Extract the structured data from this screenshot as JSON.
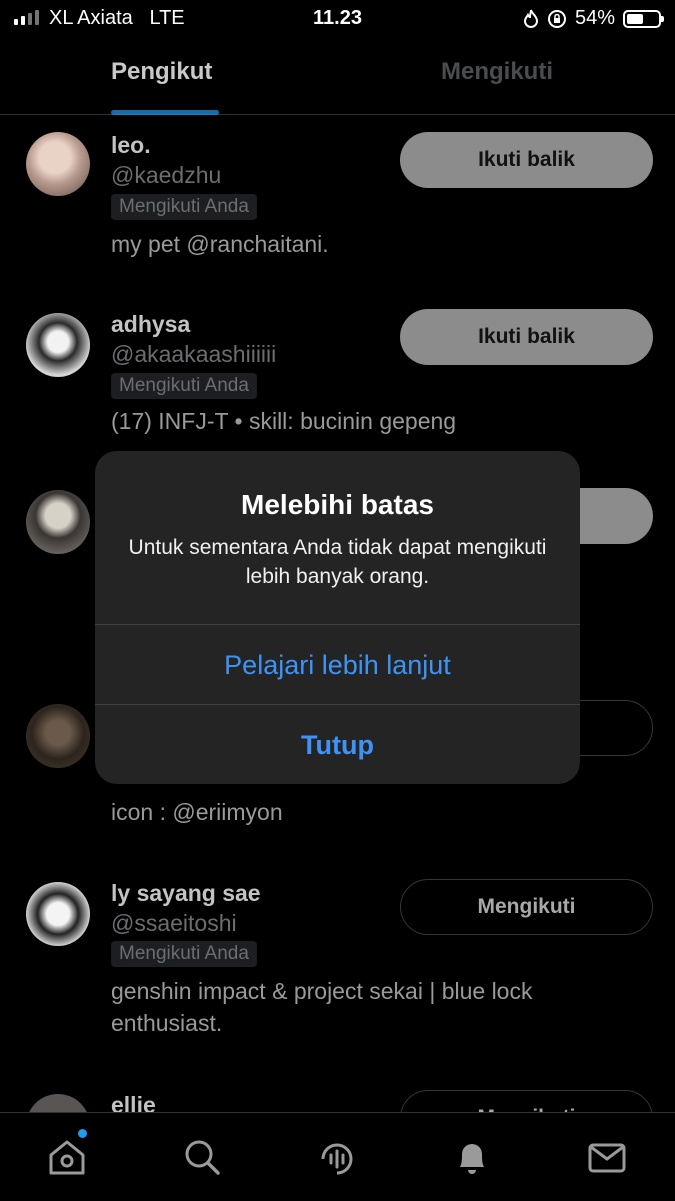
{
  "status_bar": {
    "carrier": "XL Axiata",
    "network": "LTE",
    "time": "11.23",
    "battery": "54%",
    "battery_level": 0.54
  },
  "tabs": [
    {
      "label": "Pengikut",
      "active": true
    },
    {
      "label": "Mengikuti",
      "active": false
    }
  ],
  "followers": [
    {
      "name": "leo.",
      "handle": "@kaedzhu",
      "badge": "Mengikuti Anda",
      "bio": "my pet @ranchaitani.",
      "button": "Ikuti balik"
    },
    {
      "name": "adhysa",
      "handle": "@akaakaashiiiiii",
      "badge": "Mengikuti Anda",
      "bio": "(17) INFJ-T • skill: bucinin gepeng",
      "button": "Ikuti balik"
    },
    {
      "name": "",
      "handle": "",
      "badge": "",
      "bio": "",
      "button": ""
    },
    {
      "name": "",
      "handle": "",
      "badge": "",
      "bio": "icon : @eriimyon",
      "button": ""
    },
    {
      "name": "ly sayang sae",
      "handle": "@ssaeitoshi",
      "badge": "Mengikuti Anda",
      "bio": "genshin impact & project sekai | blue lock enthusiast.",
      "button": "Mengikuti"
    },
    {
      "name": "ellie",
      "handle": "",
      "badge": "",
      "bio": "",
      "button": "Mengikuti"
    }
  ],
  "modal": {
    "title": "Melebihi batas",
    "message": "Untuk sementara Anda tidak dapat mengikuti lebih banyak orang.",
    "learn_more": "Pelajari lebih lanjut",
    "close": "Tutup"
  },
  "bottom_nav": [
    "home-icon",
    "search-icon",
    "spaces-icon",
    "notifications-icon",
    "messages-icon"
  ],
  "colors": {
    "accent": "#1d9bf0",
    "alert_action": "#3d94f6"
  }
}
